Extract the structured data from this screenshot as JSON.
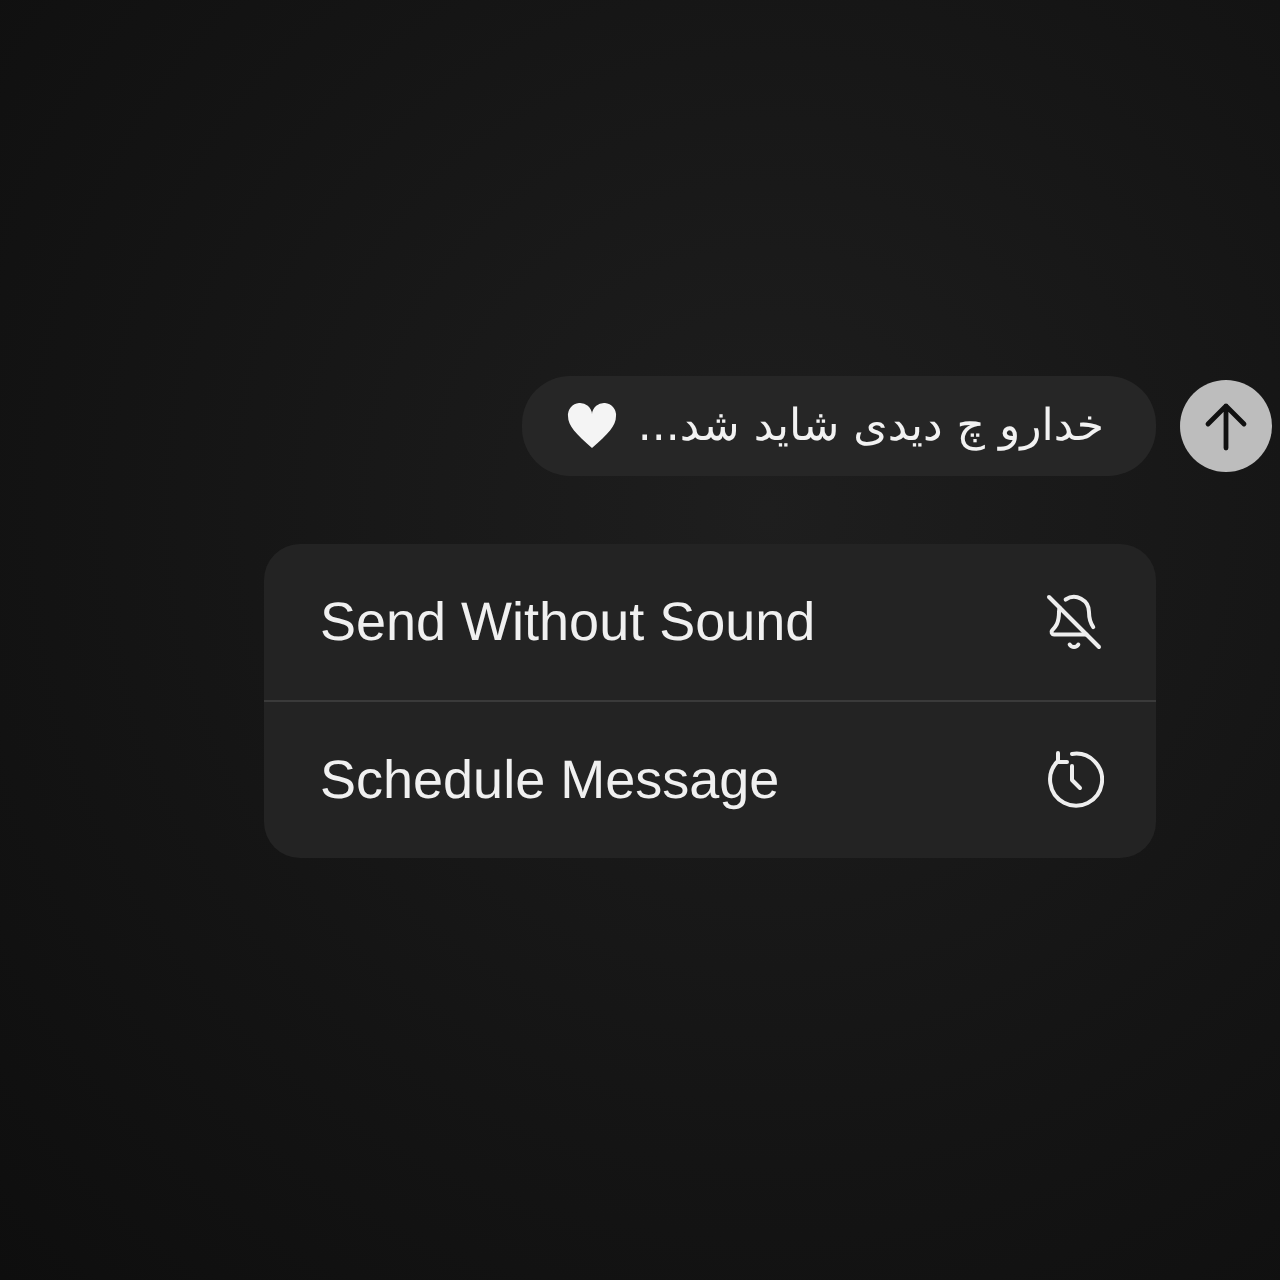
{
  "message": {
    "text": "خدارو چ دیدی شاید شد..."
  },
  "menu": [
    {
      "label": "Send Without Sound",
      "kind": "mute"
    },
    {
      "label": "Schedule Message",
      "kind": "schedule"
    }
  ]
}
